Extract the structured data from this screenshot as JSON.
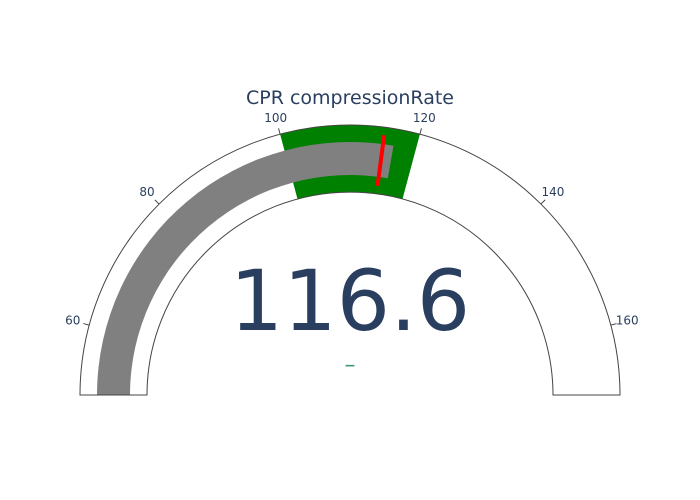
{
  "chart_data": {
    "type": "gauge",
    "title": "CPR compressionRate",
    "value": 116.6,
    "value_text": "116.6",
    "delta_text": "−",
    "delta_color": "#3d9970",
    "range": [
      50,
      170
    ],
    "ticks": [
      60,
      80,
      100,
      120,
      140,
      160
    ],
    "tick_labels": [
      "60",
      "80",
      "100",
      "120",
      "140",
      "160"
    ],
    "steps": [
      {
        "range": [
          100,
          120
        ],
        "color": "#008000"
      }
    ],
    "bar_color": "#808080",
    "threshold": {
      "value": 115,
      "color": "#ff0000"
    },
    "colors": {
      "text": "#2a3f5f",
      "outline": "#444444",
      "background": "#ffffff"
    }
  }
}
